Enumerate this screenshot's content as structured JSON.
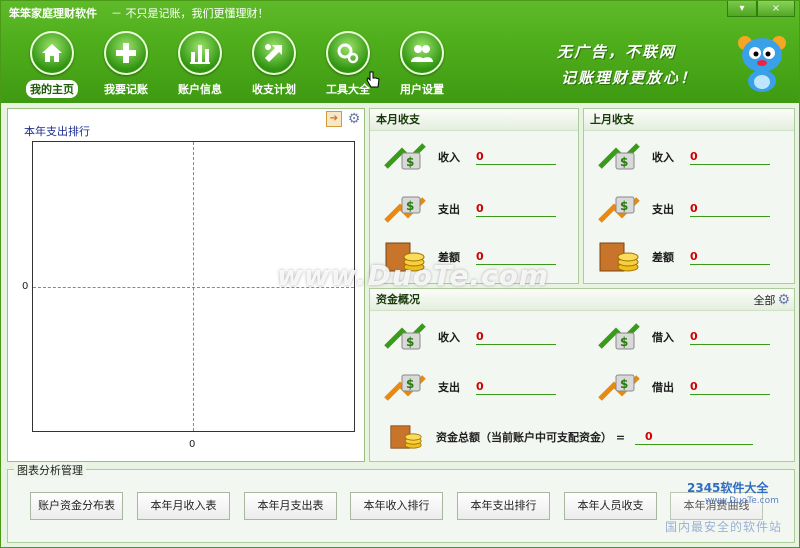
{
  "window": {
    "title": "笨笨家庭理财软件",
    "slogan": "－ 不只是记账，我们更懂理财！",
    "minimize": "▾",
    "close": "×"
  },
  "toolbar": {
    "items": [
      {
        "label": "我的主页",
        "icon": "home-icon"
      },
      {
        "label": "我要记账",
        "icon": "plus-icon"
      },
      {
        "label": "账户信息",
        "icon": "bar-chart-icon"
      },
      {
        "label": "收支计划",
        "icon": "exchange-icon"
      },
      {
        "label": "工具大全",
        "icon": "gears-icon"
      },
      {
        "label": "用户设置",
        "icon": "users-icon"
      }
    ]
  },
  "ad": {
    "line1": "无广告，不联网",
    "line2": "记账理财更放心！"
  },
  "chart": {
    "title": "本年支出排行",
    "ytick": "0",
    "xtick": "0"
  },
  "this_month": {
    "title": "本月收支",
    "rows": [
      {
        "label": "收入",
        "value": "0"
      },
      {
        "label": "支出",
        "value": "0"
      },
      {
        "label": "差额",
        "value": "0"
      }
    ]
  },
  "last_month": {
    "title": "上月收支",
    "rows": [
      {
        "label": "收入",
        "value": "0"
      },
      {
        "label": "支出",
        "value": "0"
      },
      {
        "label": "差额",
        "value": "0"
      }
    ]
  },
  "funds": {
    "title": "资金概况",
    "all_label": "全部",
    "rows": [
      {
        "label": "收入",
        "value": "0"
      },
      {
        "label": "支出",
        "value": "0"
      },
      {
        "label": "借入",
        "value": "0"
      },
      {
        "label": "借出",
        "value": "0"
      }
    ],
    "total_label": "资金总额（当前账户中可支配资金）  =",
    "total_value": "0"
  },
  "analysis": {
    "title": "图表分析管理",
    "buttons": [
      "账户资金分布表",
      "本年月收入表",
      "本年月支出表",
      "本年收入排行",
      "本年支出排行",
      "本年人员收支",
      "本年消费曲线"
    ]
  },
  "watermarks": {
    "duote": "www.DuoTe.com",
    "site_a": "2345软件大全",
    "site_b": "www.DuoTe.com",
    "site_c": "国内最安全的软件站"
  }
}
